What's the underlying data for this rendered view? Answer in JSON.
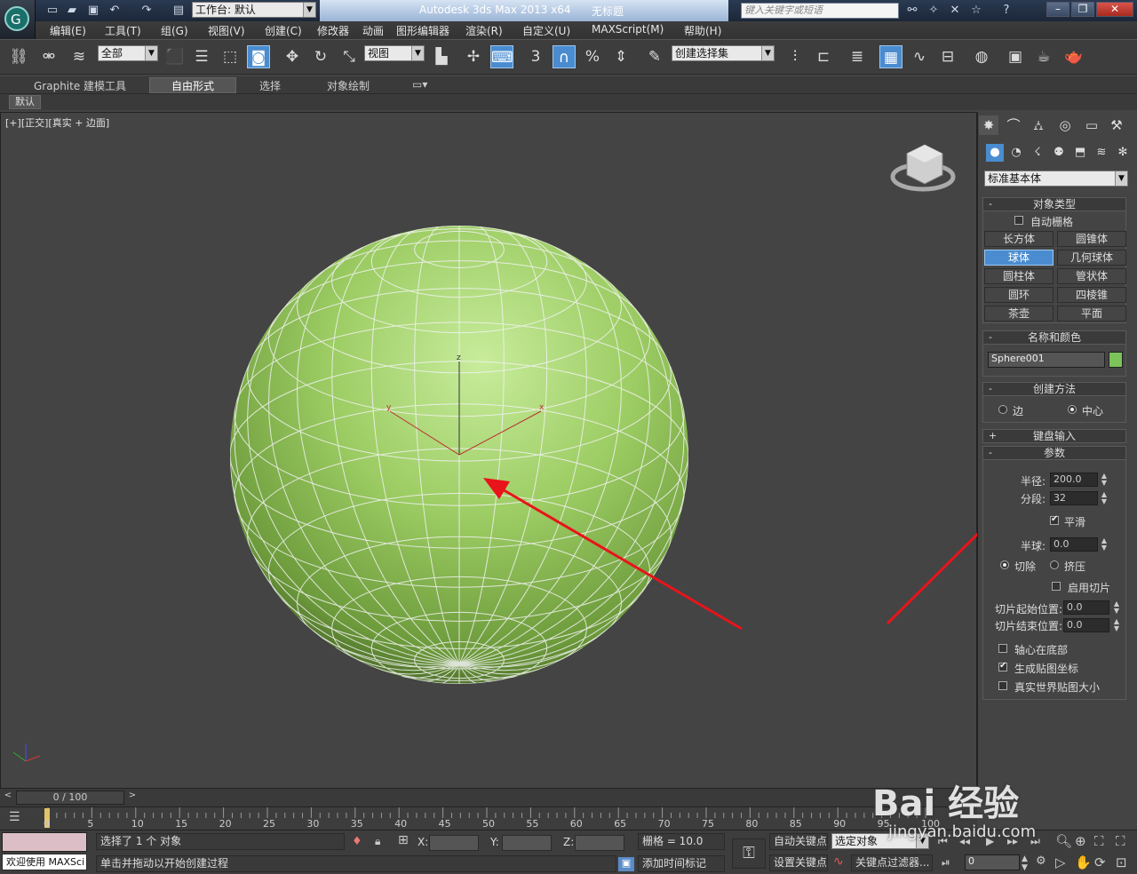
{
  "window": {
    "app_title": "Autodesk 3ds Max  2013 x64",
    "doc_title": "无标题",
    "workspace": "工作台: 默认",
    "search_placeholder": "键入关键字或短语"
  },
  "menu": [
    "编辑(E)",
    "工具(T)",
    "组(G)",
    "视图(V)",
    "创建(C)",
    "修改器",
    "动画",
    "图形编辑器",
    "渲染(R)",
    "自定义(U)",
    "MAXScript(M)",
    "帮助(H)"
  ],
  "toolbar": {
    "filter": "全部",
    "ref_coord": "视图",
    "selection_set": "创建选择集",
    "snap_angle": "3"
  },
  "ribbon": {
    "tabs": [
      "Graphite 建模工具",
      "自由形式",
      "选择",
      "对象绘制"
    ],
    "active": "自由形式",
    "sub": "默认"
  },
  "viewport": {
    "label_plus": "[+]",
    "label_view": "[正交]",
    "label_shading": "[真实 + 边面]",
    "sphere_color": "#96c85f",
    "axes": [
      "x",
      "y",
      "z"
    ]
  },
  "panel": {
    "category": "标准基本体",
    "object_type_title": "对象类型",
    "autogrid": "自动栅格",
    "buttons": [
      "长方体",
      "圆锥体",
      "球体",
      "几何球体",
      "圆柱体",
      "管状体",
      "圆环",
      "四棱锥",
      "茶壶",
      "平面"
    ],
    "selected_button": "球体",
    "name_color_title": "名称和颜色",
    "object_name": "Sphere001",
    "object_color": "#7cc35a",
    "creation_method_title": "创建方法",
    "method_edge": "边",
    "method_center": "中心",
    "keyboard_title": "键盘输入",
    "params_title": "参数",
    "radius_label": "半径:",
    "radius_value": "200.0",
    "segments_label": "分段:",
    "segments_value": "32",
    "smooth": "平滑",
    "hemisphere_label": "半球:",
    "hemisphere_value": "0.0",
    "chop": "切除",
    "squash": "挤压",
    "slice_on": "启用切片",
    "slice_from_label": "切片起始位置:",
    "slice_from_value": "0.0",
    "slice_to_label": "切片结束位置:",
    "slice_to_value": "0.0",
    "base_pivot": "轴心在底部",
    "gen_mapping": "生成贴图坐标",
    "real_world": "真实世界贴图大小"
  },
  "timeline": {
    "slider": "0 / 100",
    "ticks": [
      "0",
      "5",
      "10",
      "15",
      "20",
      "25",
      "30",
      "35",
      "40",
      "45",
      "50",
      "55",
      "60",
      "65",
      "70",
      "75",
      "80",
      "85",
      "90",
      "95",
      "100"
    ]
  },
  "status": {
    "welcome": "欢迎使用 MAXSci",
    "selected": "选择了 1 个 对象",
    "prompt": "单击并拖动以开始创建过程",
    "x_label": "X:",
    "y_label": "Y:",
    "z_label": "Z:",
    "grid": "栅格 = 10.0",
    "add_time_tag": "添加时间标记",
    "auto_key": "自动关键点",
    "selected_obj": "选定对象",
    "set_key": "设置关键点",
    "key_filter": "关键点过滤器...",
    "frame": "0"
  },
  "watermark": {
    "text": "Bai 经验",
    "sub": "jingyan.baidu.com"
  }
}
